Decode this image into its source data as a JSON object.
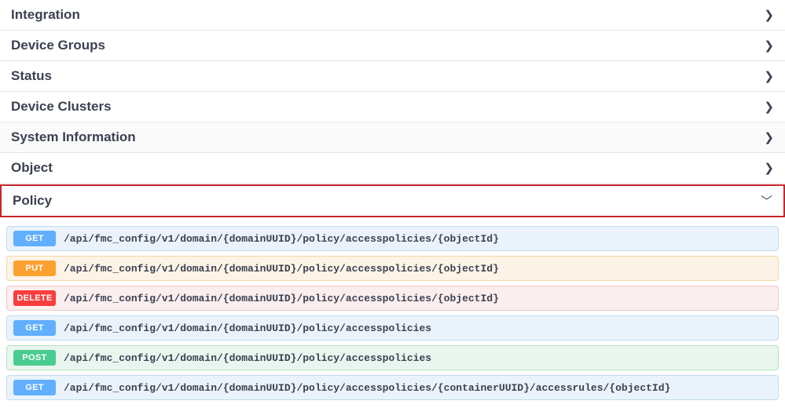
{
  "sections": [
    {
      "key": "integration",
      "title": "Integration",
      "alt": false,
      "highlight": false,
      "expanded": false
    },
    {
      "key": "devgroups",
      "title": "Device Groups",
      "alt": false,
      "highlight": false,
      "expanded": false
    },
    {
      "key": "status",
      "title": "Status",
      "alt": false,
      "highlight": false,
      "expanded": false
    },
    {
      "key": "devclusters",
      "title": "Device Clusters",
      "alt": false,
      "highlight": false,
      "expanded": false
    },
    {
      "key": "sysinfo",
      "title": "System Information",
      "alt": true,
      "highlight": false,
      "expanded": false
    },
    {
      "key": "object",
      "title": "Object",
      "alt": false,
      "highlight": false,
      "expanded": false
    },
    {
      "key": "policy",
      "title": "Policy",
      "alt": false,
      "highlight": true,
      "expanded": true
    }
  ],
  "chevrons": {
    "collapsed": "❯",
    "expanded": "﹀"
  },
  "endpoints": [
    {
      "method": "GET",
      "class": "get",
      "path": "/api/fmc_config/v1/domain/{domainUUID}/policy/accesspolicies/{objectId}"
    },
    {
      "method": "PUT",
      "class": "put",
      "path": "/api/fmc_config/v1/domain/{domainUUID}/policy/accesspolicies/{objectId}"
    },
    {
      "method": "DELETE",
      "class": "delete",
      "path": "/api/fmc_config/v1/domain/{domainUUID}/policy/accesspolicies/{objectId}"
    },
    {
      "method": "GET",
      "class": "get",
      "path": "/api/fmc_config/v1/domain/{domainUUID}/policy/accesspolicies"
    },
    {
      "method": "POST",
      "class": "post",
      "path": "/api/fmc_config/v1/domain/{domainUUID}/policy/accesspolicies"
    },
    {
      "method": "GET",
      "class": "get",
      "path": "/api/fmc_config/v1/domain/{domainUUID}/policy/accesspolicies/{containerUUID}/accessrules/{objectId}"
    }
  ]
}
